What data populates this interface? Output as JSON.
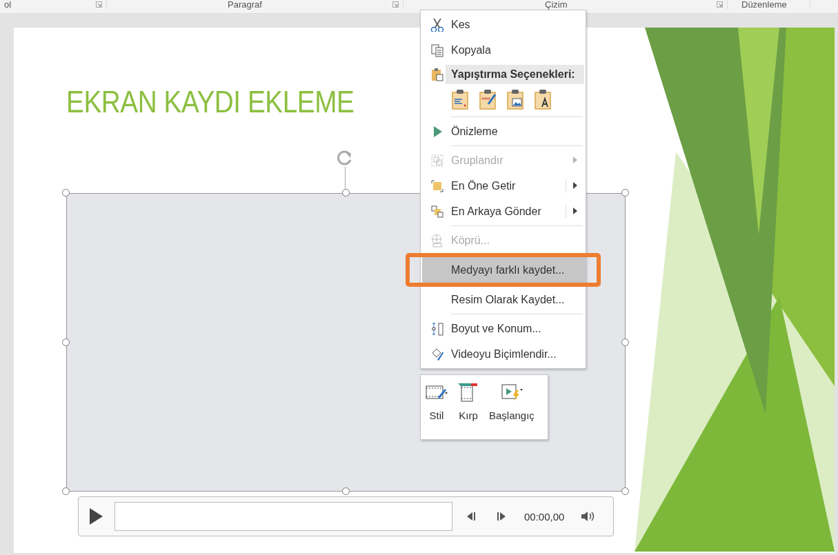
{
  "ribbon_groups": [
    "ol",
    "Paragraf",
    "Çizim",
    "Düzenleme"
  ],
  "slide": {
    "title": "EKRAN KAYDI EKLEME"
  },
  "context_menu": [
    {
      "kind": "cut",
      "label": "Kes",
      "disabled": false,
      "submenu": false,
      "selected": false
    },
    {
      "kind": "copy",
      "label": "Kopyala",
      "disabled": false,
      "submenu": false,
      "selected": false
    },
    {
      "kind": "pasteheader",
      "label": "Yapıştırma Seçenekleri:"
    },
    {
      "kind": "pasteoptions"
    },
    {
      "kind": "preview",
      "label": "Önizleme",
      "disabled": false,
      "submenu": false,
      "selected": false,
      "separator_before": true
    },
    {
      "kind": "group",
      "label": "Gruplandır",
      "disabled": true,
      "submenu": true,
      "selected": false,
      "separator_before": true
    },
    {
      "kind": "front",
      "label": "En Öne Getir",
      "disabled": false,
      "submenu": true,
      "selected": false
    },
    {
      "kind": "back",
      "label": "En Arkaya Gönder",
      "disabled": false,
      "submenu": true,
      "selected": false
    },
    {
      "kind": "link",
      "label": "Köprü...",
      "disabled": true,
      "submenu": false,
      "selected": false,
      "separator_before": true
    },
    {
      "kind": "savemedia",
      "label": "Medyayı farklı kaydet...",
      "disabled": false,
      "submenu": false,
      "selected": true
    },
    {
      "kind": "savepicture",
      "label": "Resim Olarak Kaydet...",
      "disabled": false,
      "submenu": false,
      "selected": false
    },
    {
      "kind": "size",
      "label": "Boyut ve Konum...",
      "disabled": false,
      "submenu": false,
      "selected": false,
      "separator_before": true
    },
    {
      "kind": "format",
      "label": "Videoyu Biçimlendir...",
      "disabled": false,
      "submenu": false,
      "selected": false
    }
  ],
  "mini_toolbar": [
    {
      "kind": "style",
      "label": "Stil"
    },
    {
      "kind": "crop",
      "label": "Kırp"
    },
    {
      "kind": "start",
      "label": "Başlangıç"
    }
  ],
  "player": {
    "time": "00:00,00"
  }
}
